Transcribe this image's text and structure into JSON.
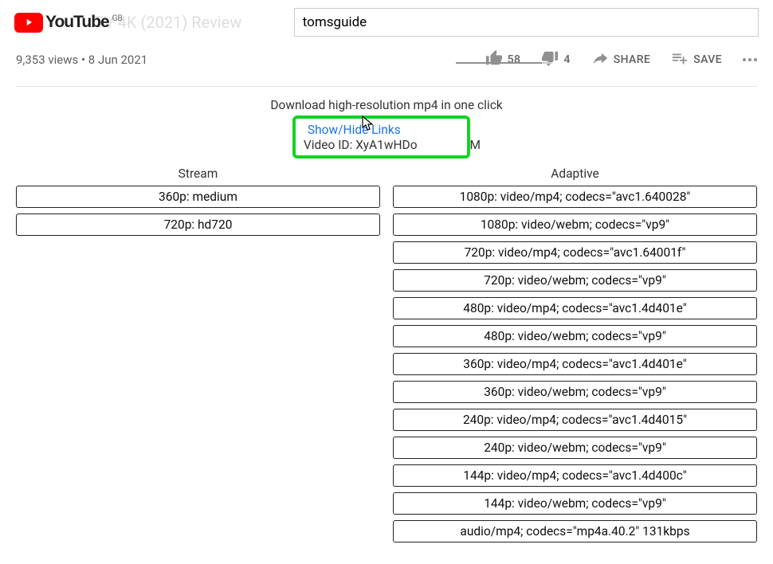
{
  "header": {
    "brand": "YouTube",
    "region_badge": "GB",
    "background_title": "TV 4K (2021) Review",
    "search_value": "tomsguide"
  },
  "meta": {
    "views": "9,353 views",
    "dot": " • ",
    "date": "8 Jun 2021"
  },
  "actions": {
    "like_count": "58",
    "dislike_count": "4",
    "share_label": "SHARE",
    "save_label": "SAVE"
  },
  "extension": {
    "headline": "Download high-resolution mp4 in one click",
    "toggle_label": "Show/Hide Links",
    "video_id_prefix": "Video ID: ",
    "video_id_value": "XyA1wHDo",
    "video_id_suffix_visible": "M"
  },
  "tables": {
    "stream_header": "Stream",
    "adaptive_header": "Adaptive",
    "stream": [
      "360p: medium",
      "720p: hd720"
    ],
    "adaptive": [
      "1080p: video/mp4; codecs=\"avc1.640028\"",
      "1080p: video/webm; codecs=\"vp9\"",
      "720p: video/mp4; codecs=\"avc1.64001f\"",
      "720p: video/webm; codecs=\"vp9\"",
      "480p: video/mp4; codecs=\"avc1.4d401e\"",
      "480p: video/webm; codecs=\"vp9\"",
      "360p: video/mp4; codecs=\"avc1.4d401e\"",
      "360p: video/webm; codecs=\"vp9\"",
      "240p: video/mp4; codecs=\"avc1.4d4015\"",
      "240p: video/webm; codecs=\"vp9\"",
      "144p: video/mp4; codecs=\"avc1.4d400c\"",
      "144p: video/webm; codecs=\"vp9\"",
      "audio/mp4; codecs=\"mp4a.40.2\" 131kbps"
    ]
  }
}
